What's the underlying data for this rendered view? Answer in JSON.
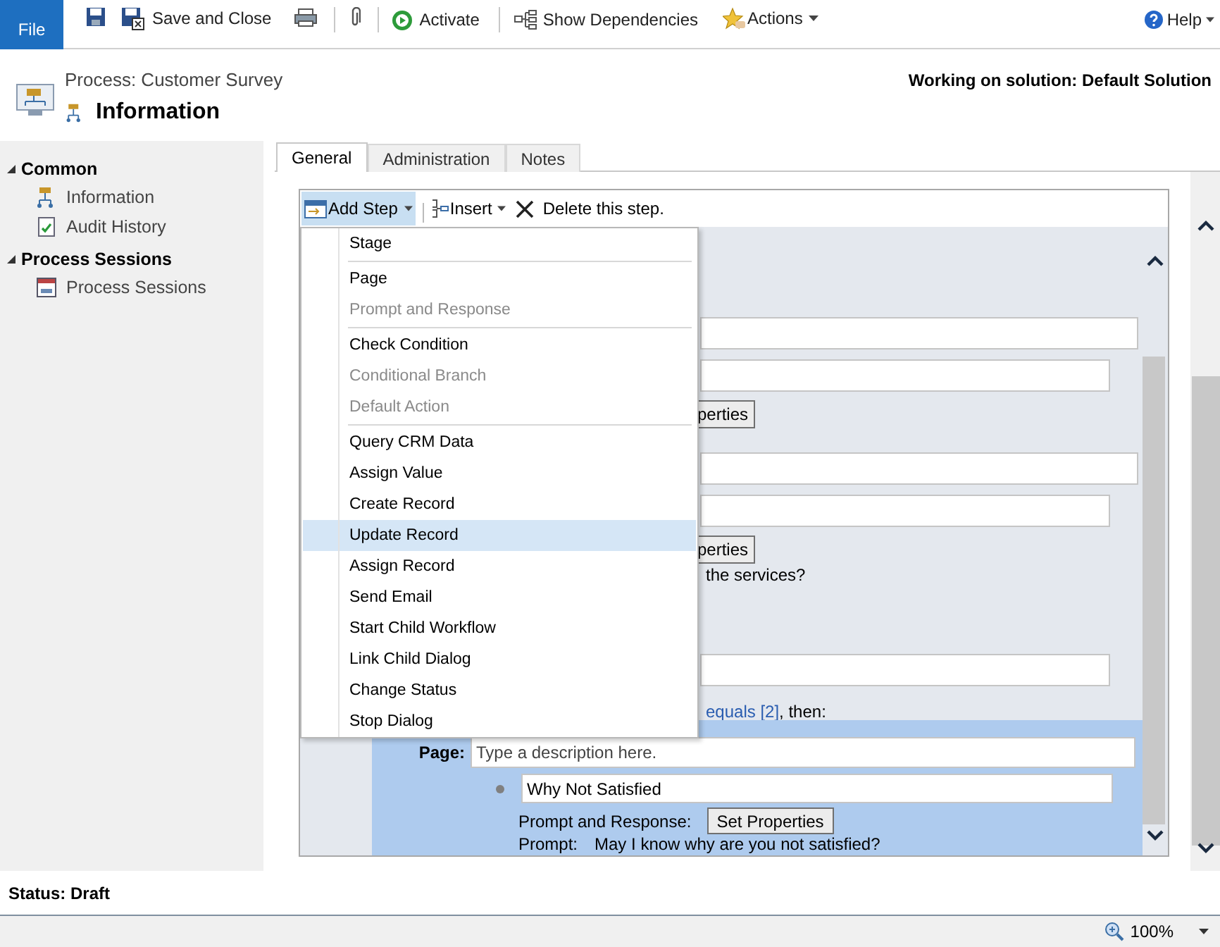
{
  "ribbon": {
    "file": "File",
    "save_and_close": "Save and Close",
    "activate": "Activate",
    "show_dependencies": "Show Dependencies",
    "actions": "Actions",
    "help": "Help"
  },
  "header": {
    "subtitle": "Process: Customer Survey",
    "title": "Information",
    "solution": "Working on solution: Default Solution"
  },
  "sidebar": {
    "sections": [
      {
        "label": "Common",
        "expanded": true,
        "items": [
          {
            "label": "Information",
            "kind": "flow"
          },
          {
            "label": "Audit History",
            "kind": "audit"
          }
        ]
      },
      {
        "label": "Process Sessions",
        "expanded": true,
        "items": [
          {
            "label": "Process Sessions",
            "kind": "sessions"
          }
        ]
      }
    ]
  },
  "tabs": [
    {
      "label": "General",
      "selected": true
    },
    {
      "label": "Administration",
      "selected": false
    },
    {
      "label": "Notes",
      "selected": false
    }
  ],
  "designer_toolbar": {
    "add_step": "Add Step",
    "add_step_open": true,
    "insert": "Insert",
    "delete": "Delete this step."
  },
  "add_step_menu": [
    [
      {
        "label": "Stage",
        "disabled": false,
        "selected": false
      }
    ],
    [
      {
        "label": "Page",
        "disabled": false,
        "selected": false
      },
      {
        "label": "Prompt and Response",
        "disabled": true,
        "selected": false
      }
    ],
    [
      {
        "label": "Check Condition",
        "disabled": false,
        "selected": false
      },
      {
        "label": "Conditional Branch",
        "disabled": true,
        "selected": false
      },
      {
        "label": "Default Action",
        "disabled": true,
        "selected": false
      }
    ],
    [
      {
        "label": "Query CRM Data",
        "disabled": false,
        "selected": false
      },
      {
        "label": "Assign Value",
        "disabled": false,
        "selected": false
      },
      {
        "label": "Create Record",
        "disabled": false,
        "selected": false
      },
      {
        "label": "Update Record",
        "disabled": false,
        "selected": true
      },
      {
        "label": "Assign Record",
        "disabled": false,
        "selected": false
      },
      {
        "label": "Send Email",
        "disabled": false,
        "selected": false
      },
      {
        "label": "Start Child Workflow",
        "disabled": false,
        "selected": false
      },
      {
        "label": "Link Child Dialog",
        "disabled": false,
        "selected": false
      },
      {
        "label": "Change Status",
        "disabled": false,
        "selected": false
      },
      {
        "label": "Stop Dialog",
        "disabled": false,
        "selected": false
      }
    ]
  ],
  "steps_behind_menu": [
    {
      "kind": "field",
      "wide": true
    },
    {
      "kind": "field",
      "wide": false
    },
    {
      "kind": "button",
      "label": "perties"
    },
    {
      "kind": "field",
      "wide": true
    },
    {
      "kind": "field",
      "wide": false
    },
    {
      "kind": "button",
      "label": "perties"
    },
    {
      "kind": "text",
      "text": "the services?"
    },
    {
      "kind": "field",
      "wide": false
    },
    {
      "kind": "condition",
      "link": "equals [2]",
      "rest": ", then:"
    }
  ],
  "page_step": {
    "label": "Page:",
    "placeholder": "Type a description here.",
    "step_name": "Why Not Satisfied",
    "prompt_response_label": "Prompt and Response:",
    "set_properties": "Set Properties",
    "prompt_label": "Prompt:",
    "prompt": "May I know why are you not satisfied?"
  },
  "status": "Status: Draft",
  "zoom": "100%"
}
